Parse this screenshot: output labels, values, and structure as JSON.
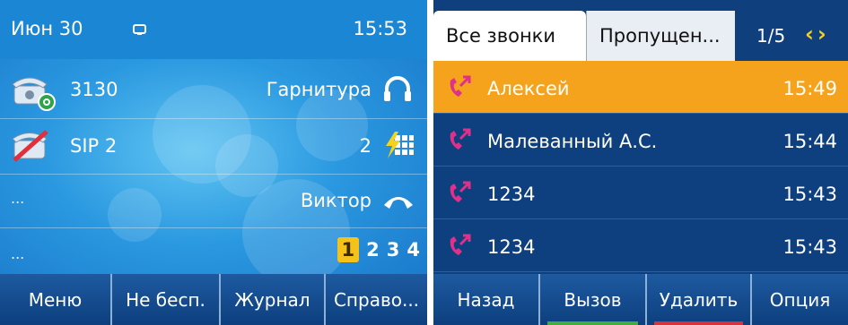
{
  "left_screen": {
    "status": {
      "date": "Июн 30",
      "time": "15:53",
      "icon": "message-icon"
    },
    "lines": [
      {
        "label": "3130",
        "icon": "phone-registered-icon"
      },
      {
        "label": "SIP 2",
        "icon": "phone-unregistered-icon"
      },
      {
        "label": "..."
      },
      {
        "label": "..."
      }
    ],
    "right_keys": [
      {
        "label": "Гарнитура",
        "icon": "headset-icon"
      },
      {
        "label": "2",
        "icon": "speed-dial-icon"
      },
      {
        "label": "Виктор",
        "icon": "handset-icon"
      }
    ],
    "pages": {
      "current": "1",
      "others": [
        "2",
        "3",
        "4"
      ]
    },
    "softkeys": [
      "Меню",
      "Не бесп.",
      "Журнал",
      "Справо..."
    ]
  },
  "right_screen": {
    "tabs": [
      "Все звонки",
      "Пропущен..."
    ],
    "page_indicator": "1/5",
    "nav_arrows": "‹›",
    "calls": [
      {
        "name": "Алексей",
        "time": "15:49",
        "selected": true
      },
      {
        "name": "Малеванный А.С.",
        "time": "15:44",
        "selected": false
      },
      {
        "name": "1234",
        "time": "15:43",
        "selected": false
      },
      {
        "name": "1234",
        "time": "15:43",
        "selected": false
      }
    ],
    "softkeys": [
      "Назад",
      "Вызов",
      "Удалить",
      "Опция"
    ],
    "softkey_accents": {
      "Вызов": "#3fae3f",
      "Удалить": "#d8323a"
    }
  },
  "colors": {
    "selected_row": "#f5a21c",
    "accent_yellow": "#f5d21c",
    "missed_call": "#e0308a"
  }
}
